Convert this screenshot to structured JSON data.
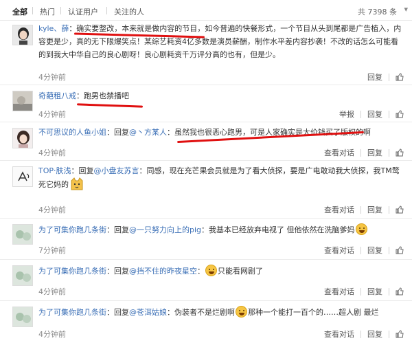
{
  "tabs": {
    "all": "全部",
    "hot": "热门",
    "verified": "认证用户",
    "following": "关注的人",
    "total": "共 7398 条"
  },
  "comments": [
    {
      "user": "kyle、薛",
      "text": "：确实要整改，本来就是做内容的节目，如今普遍的快餐形式，一个节目从头到尾都是广告植入，内容更是少，真的无下限爆笑点！某综艺耗资4亿多数是演员薪酬，制作水平差内容抄袭！不改的话怎么可能看的到我大中华自己的良心剧呀！良心剧耗资千万评分高的也有，但是少。",
      "time": "4分钟前",
      "reply": "回复"
    },
    {
      "user": "奇葩租八戒",
      "text": "：跑男也禁播吧",
      "time": "4分钟前",
      "report": "举报",
      "reply": "回复"
    },
    {
      "user": "不可思议的人鱼小姐",
      "prefix": "：回复",
      "mention": "@丶方某人",
      "text": "：虽然我也很恶心跑男，可是人家确实是大价钱买了版权的啊",
      "time": "4分钟前",
      "view": "查看对话",
      "reply": "回复"
    },
    {
      "user": "TOP·肤浅",
      "prefix": "：回复",
      "mention": "@小盘友苏言",
      "text": "：同感，现在充芒果会员就是为了看大侦探，要是广电敢动我大侦探，我TM鹜死它妈的",
      "time": "4分钟前",
      "view": "查看对话",
      "reply": "回复"
    },
    {
      "user": "为了可集你跑几条街",
      "prefix": "：回复",
      "mention": "@一只努力向上的pig",
      "text": "：我基本已经放弃电视了 但他依然在洗脑爹妈",
      "time": "7分钟前",
      "view": "查看对话",
      "reply": "回复"
    },
    {
      "user": "为了可集你跑几条街",
      "prefix": "：回复",
      "mention": "@挡不住的昨夜星空",
      "text": "：",
      "text2": "只能看网剧了",
      "time": "4分钟前",
      "view": "查看对话",
      "reply": "回复"
    },
    {
      "user": "为了可集你跑几条街",
      "prefix": "：回复",
      "mention": "@苍洱姑娘",
      "text": "：伪装者不是烂剧啊",
      "text2": "那种一个能打一百个的……超人剧 最烂",
      "time": "4分钟前",
      "view": "查看对话",
      "reply": "回复"
    }
  ],
  "colors": {
    "link": "#3b6fb6",
    "annotation": "#e01010"
  }
}
